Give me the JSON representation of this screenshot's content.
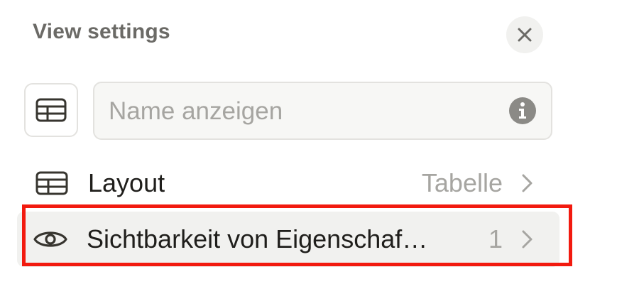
{
  "header": {
    "title": "View settings",
    "close_icon": "close-icon"
  },
  "name_field": {
    "view_icon": "table-icon",
    "value": "",
    "placeholder": "Name anzeigen",
    "info_icon": "info-icon"
  },
  "rows": [
    {
      "icon": "table-icon",
      "label": "Layout",
      "value": "Tabelle",
      "chevron": "chevron-right-icon"
    },
    {
      "icon": "eye-icon",
      "label": "Sichtbarkeit von Eigenschaf…",
      "value": "1",
      "chevron": "chevron-right-icon",
      "highlighted": true
    }
  ],
  "colors": {
    "highlight": "#f21a0f",
    "muted_text": "#a6a5a1",
    "hover_bg": "#f1f1ef"
  }
}
